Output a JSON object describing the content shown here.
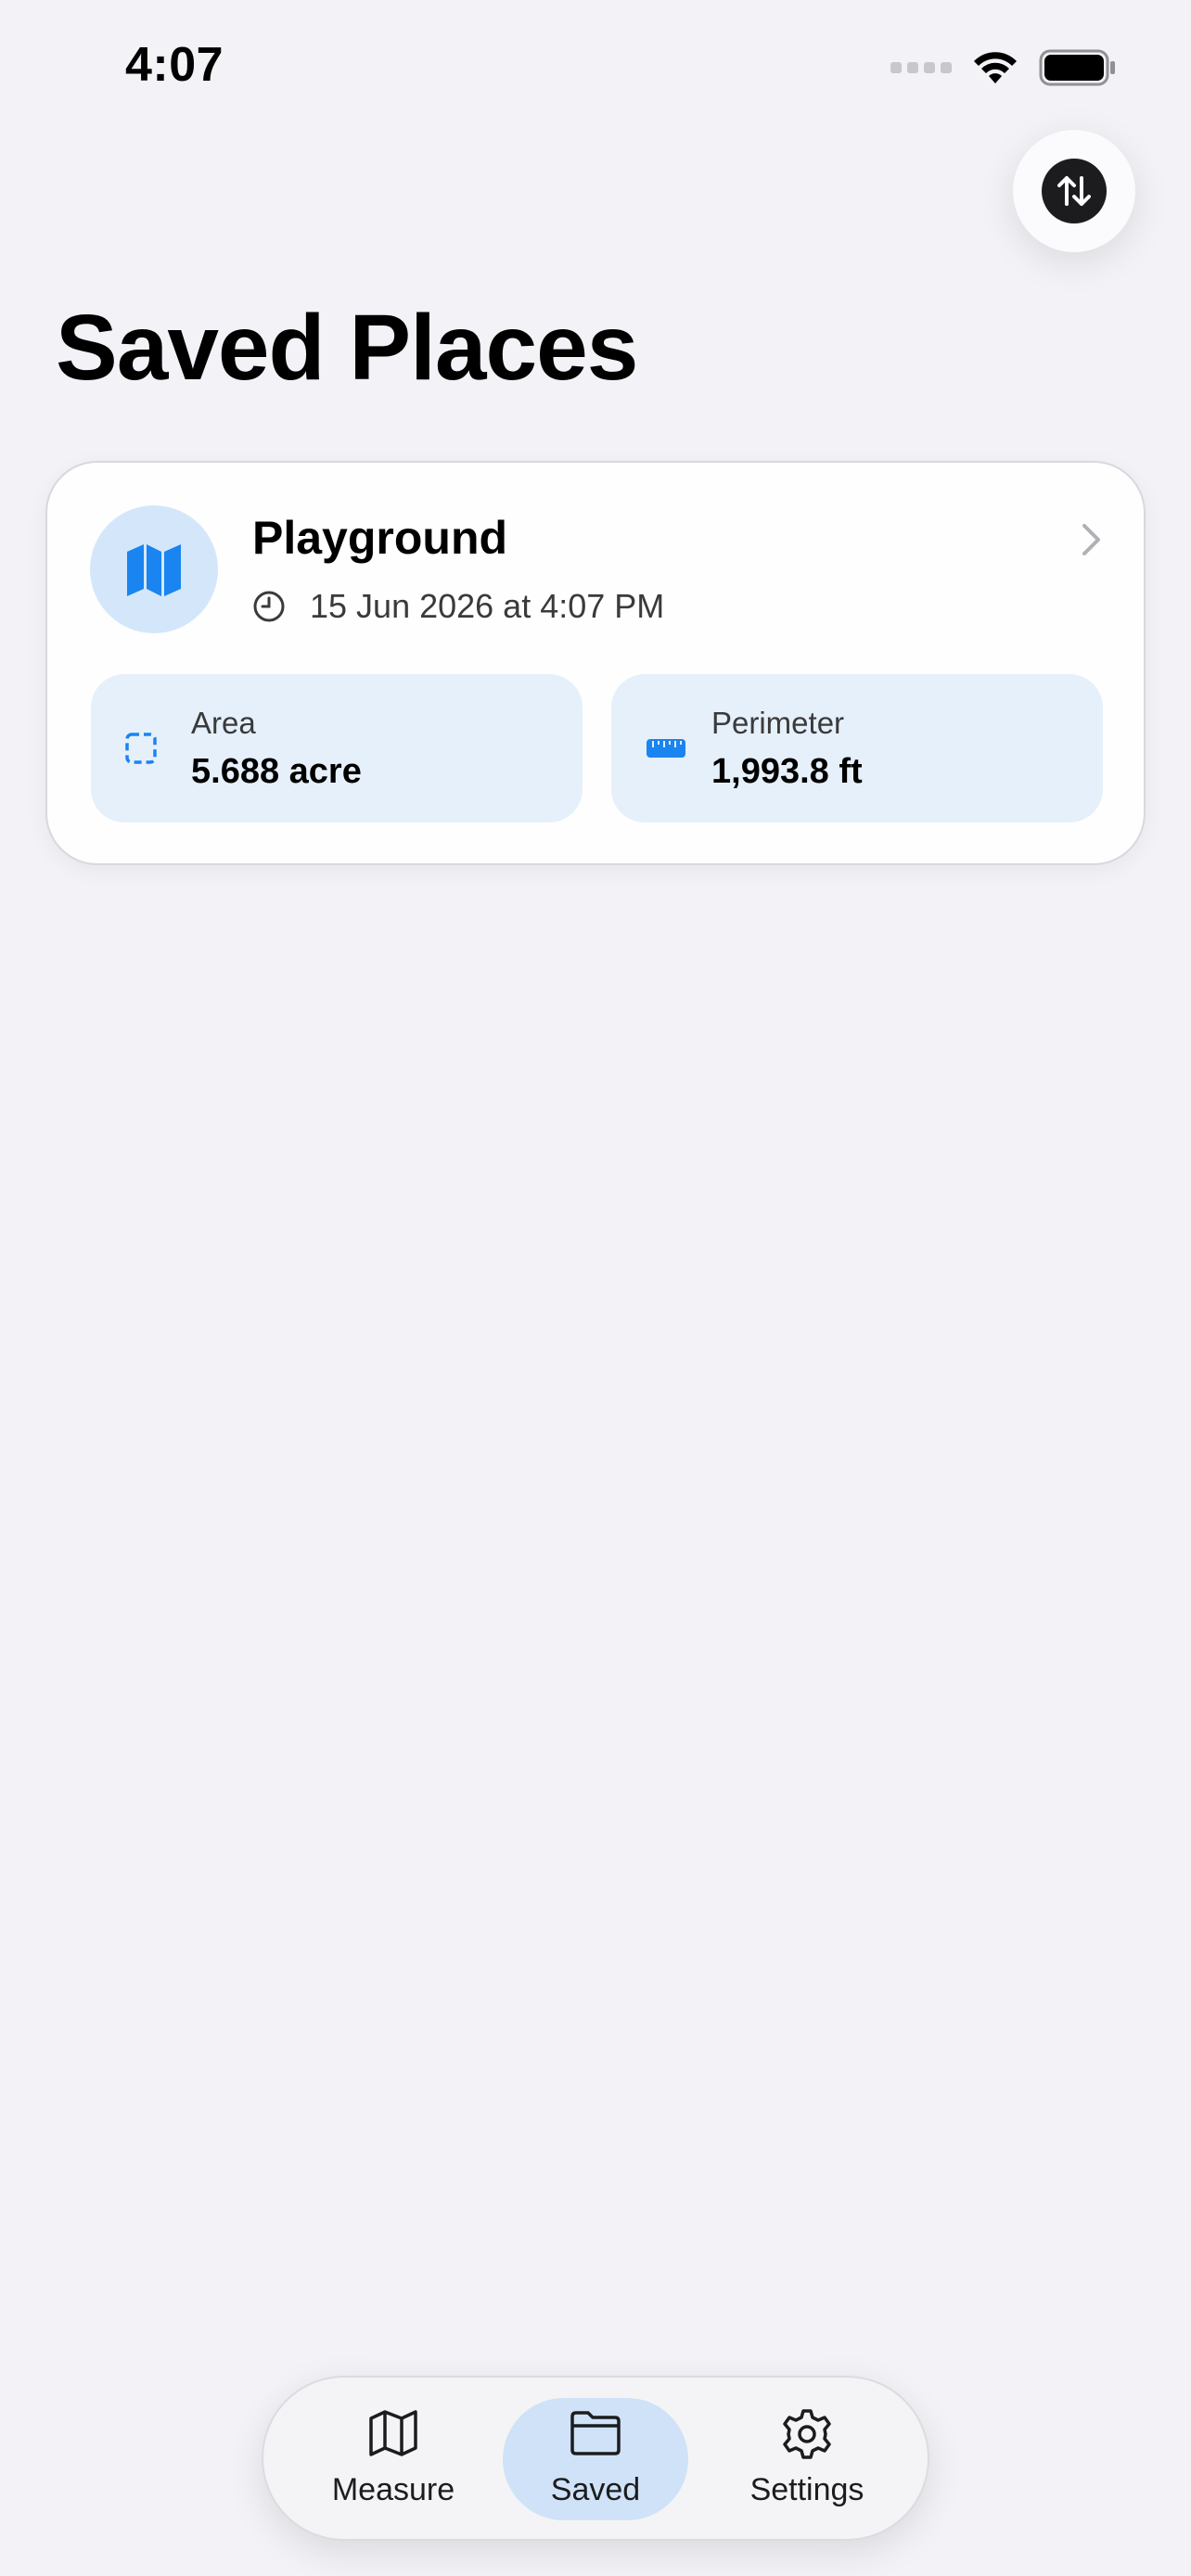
{
  "status_bar": {
    "time": "4:07"
  },
  "header": {
    "title": "Saved Places",
    "sort_icon": "sort-up-down-icon"
  },
  "places": [
    {
      "name": "Playground",
      "date": "15 Jun 2026 at 4:07 PM",
      "area": {
        "label": "Area",
        "value": "5.688 acre"
      },
      "perimeter": {
        "label": "Perimeter",
        "value": "1,993.8 ft"
      }
    }
  ],
  "tab_bar": {
    "tabs": [
      {
        "label": "Measure",
        "icon": "map-icon"
      },
      {
        "label": "Saved",
        "icon": "folder-icon",
        "selected": true
      },
      {
        "label": "Settings",
        "icon": "gear-icon"
      }
    ]
  },
  "colors": {
    "accent": "#1a84f0",
    "card_stat_bg": "#e6f0fa",
    "selected_tab_bg": "#cfe2f7"
  }
}
